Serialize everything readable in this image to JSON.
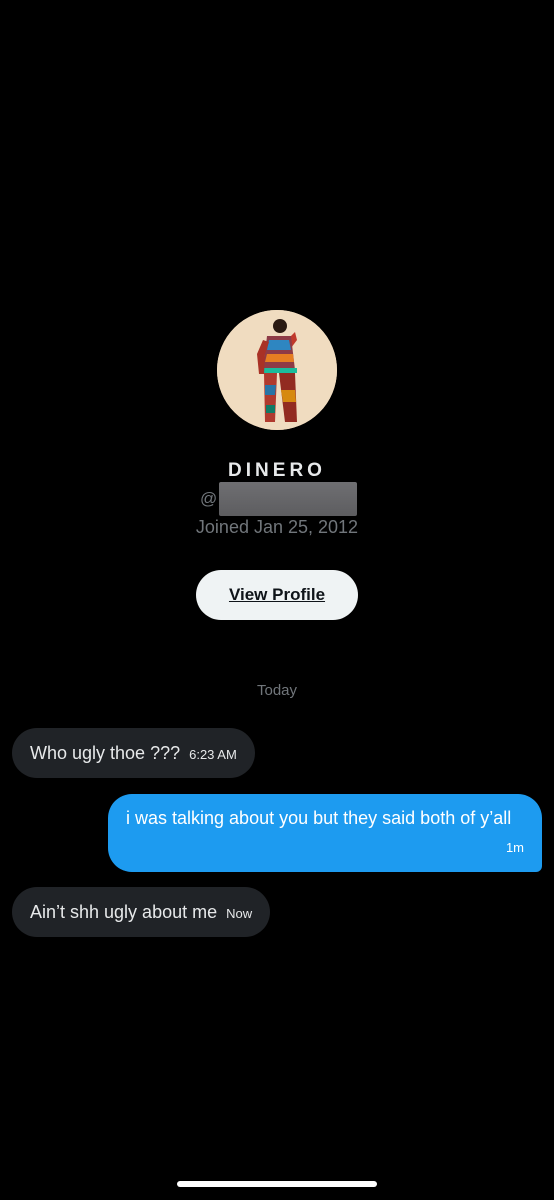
{
  "profile": {
    "display_name": "DINERO",
    "handle_prefix": "@",
    "joined": "Joined Jan 25, 2012",
    "view_profile_label": "View Profile"
  },
  "conversation": {
    "day_separator": "Today",
    "messages": [
      {
        "direction": "incoming",
        "text": "Who ugly thoe ???",
        "time": "6:23 AM"
      },
      {
        "direction": "outgoing",
        "text": "i was talking about you but they said both of y’all",
        "time": "1m"
      },
      {
        "direction": "incoming",
        "text": "Ain’t shh ugly about me",
        "time": "Now"
      }
    ]
  },
  "colors": {
    "background": "#000000",
    "incoming_bubble": "#202327",
    "outgoing_bubble": "#1d9bf0",
    "secondary_text": "#71767b",
    "button_bg": "#eff3f4"
  }
}
